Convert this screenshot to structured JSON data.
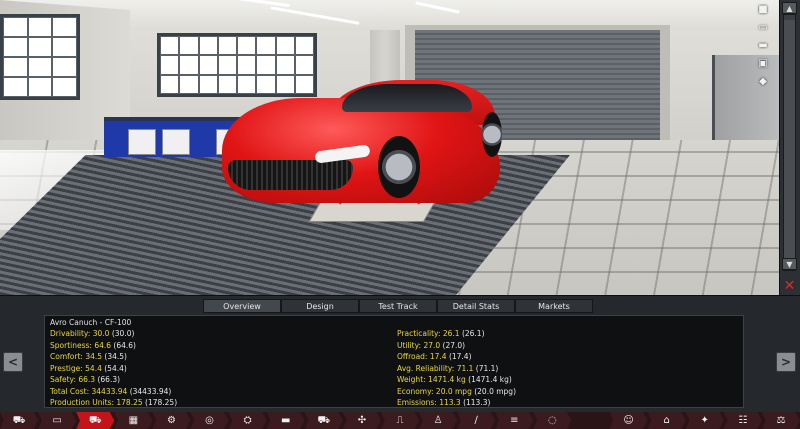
{
  "tabs": [
    {
      "label": "Overview",
      "active": true
    },
    {
      "label": "Design",
      "active": false
    },
    {
      "label": "Test Track",
      "active": false
    },
    {
      "label": "Detail Stats",
      "active": false
    },
    {
      "label": "Markets",
      "active": false
    }
  ],
  "car_name": "Avro Canuch - CF-100",
  "stats_left": [
    {
      "label": "Drivability:",
      "value": "30.0",
      "base": "(30.0)"
    },
    {
      "label": "Sportiness:",
      "value": "64.6",
      "base": "(64.6)"
    },
    {
      "label": "Comfort:",
      "value": "34.5",
      "base": "(34.5)"
    },
    {
      "label": "Prestige:",
      "value": "54.4",
      "base": "(54.4)"
    },
    {
      "label": "Safety:",
      "value": "66.3",
      "base": "(66.3)"
    },
    {
      "label": "Total Cost:",
      "value": "34433.94",
      "base": "(34433.94)"
    },
    {
      "label": "Production Units:",
      "value": "178.25",
      "base": "(178.25)"
    }
  ],
  "stats_right": [
    {
      "label": "Practicality:",
      "value": "26.1",
      "base": "(26.1)"
    },
    {
      "label": "Utility:",
      "value": "27.0",
      "base": "(27.0)"
    },
    {
      "label": "Offroad:",
      "value": "17.4",
      "base": "(17.4)"
    },
    {
      "label": "Avg. Reliability:",
      "value": "71.1",
      "base": "(71.1)"
    },
    {
      "label": "Weight:",
      "value": "1471.4 kg",
      "base": "(1471.4 kg)"
    },
    {
      "label": "Economy:",
      "value": "20.0 mpg",
      "base": "(20.0 mpg)"
    },
    {
      "label": "Emissions:",
      "value": "113.3",
      "base": "(113.3)"
    }
  ],
  "nav": {
    "prev": "<",
    "next": ">"
  },
  "camera_icons": [
    "camera-icon",
    "car-front-icon",
    "car-side-icon",
    "car-top-icon",
    "car-angle-icon"
  ],
  "bottom_menu": [
    {
      "icon": "truck-icon",
      "glyph": "⛟",
      "active": false
    },
    {
      "icon": "chassis-icon",
      "glyph": "▭",
      "active": false
    },
    {
      "icon": "car-model-icon",
      "glyph": "⛟",
      "active": true
    },
    {
      "icon": "engine-block-icon",
      "glyph": "▦",
      "active": false
    },
    {
      "icon": "gearbox-icon",
      "glyph": "⚙",
      "active": false
    },
    {
      "icon": "wheels-icon",
      "glyph": "◎",
      "active": false
    },
    {
      "icon": "suspension-icon",
      "glyph": "⛭",
      "active": false
    },
    {
      "icon": "body-icon",
      "glyph": "▬",
      "active": false
    },
    {
      "icon": "car-body-icon",
      "glyph": "⛟",
      "active": false
    },
    {
      "icon": "steering-icon",
      "glyph": "✣",
      "active": false
    },
    {
      "icon": "interior-icon",
      "glyph": "⎍",
      "active": false
    },
    {
      "icon": "seat-icon",
      "glyph": "♙",
      "active": false
    },
    {
      "icon": "exhaust-icon",
      "glyph": "∕",
      "active": false
    },
    {
      "icon": "tuning-icon",
      "glyph": "≡",
      "active": false
    },
    {
      "icon": "test-track-icon",
      "glyph": "◌",
      "active": false
    },
    {
      "icon": "dark-segment",
      "glyph": "",
      "active": false,
      "dark": true
    },
    {
      "icon": "engineer-icon",
      "glyph": "☺",
      "active": false
    },
    {
      "icon": "factory-icon",
      "glyph": "⌂",
      "active": false
    },
    {
      "icon": "gears-icon",
      "glyph": "✦",
      "active": false
    },
    {
      "icon": "market-icon",
      "glyph": "☷",
      "active": false
    },
    {
      "icon": "balance-icon",
      "glyph": "⚖",
      "active": false
    }
  ]
}
